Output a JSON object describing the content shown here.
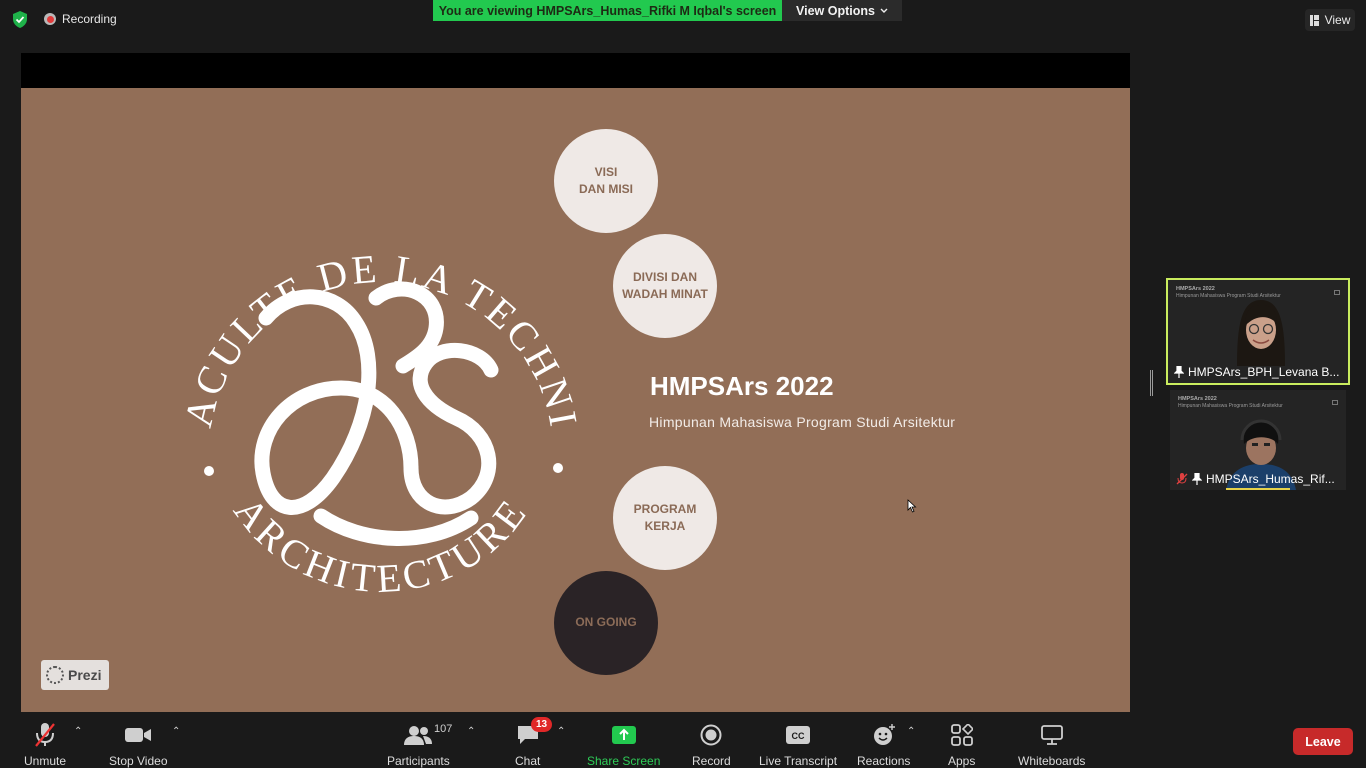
{
  "top": {
    "recording_label": "Recording",
    "viewing_banner": "You are viewing HMPSArs_Humas_Rifki M Iqbal's screen",
    "view_options_label": "View Options",
    "view_label": "View"
  },
  "slide": {
    "emblem_top_text": "LA FACULTE DE LA TECHNIQUE",
    "emblem_bottom_text": "ARCHITECTURE",
    "bubbles": [
      {
        "label": "VISI\nDAN MISI"
      },
      {
        "label": "DIVISI DAN\nWADAH MINAT"
      },
      {
        "label": "PROGRAM\nKERJA"
      },
      {
        "label": "ON GOING"
      }
    ],
    "title": "HMPSArs 2022",
    "subtitle": "Himpunan Mahasiswa Program Studi Arsitektur",
    "prezi_label": "Prezi"
  },
  "participants_tiles": [
    {
      "name": "HMPSArs_BPH_Levana B...",
      "mini_title": "HMPSArs 2022",
      "mini_sub": "Himpunan Mahasiswa Program Studi Arsitektur",
      "active": true
    },
    {
      "name": "HMPSArs_Humas_Rif...",
      "mini_title": "HMPSArs 2022",
      "mini_sub": "Himpunan Mahasiswa Program Studi Arsitektur",
      "active": false
    }
  ],
  "toolbar": {
    "unmute": "Unmute",
    "stop_video": "Stop Video",
    "participants": "Participants",
    "participants_count": "107",
    "chat": "Chat",
    "chat_badge": "13",
    "share_screen": "Share Screen",
    "record": "Record",
    "live_transcript": "Live Transcript",
    "reactions": "Reactions",
    "apps": "Apps",
    "whiteboards": "Whiteboards",
    "leave": "Leave"
  },
  "colors": {
    "slide_bg": "#926e57",
    "share_green": "#22c94f",
    "active_tile_border": "#c9ec5e",
    "leave_red": "#c72a2a"
  }
}
